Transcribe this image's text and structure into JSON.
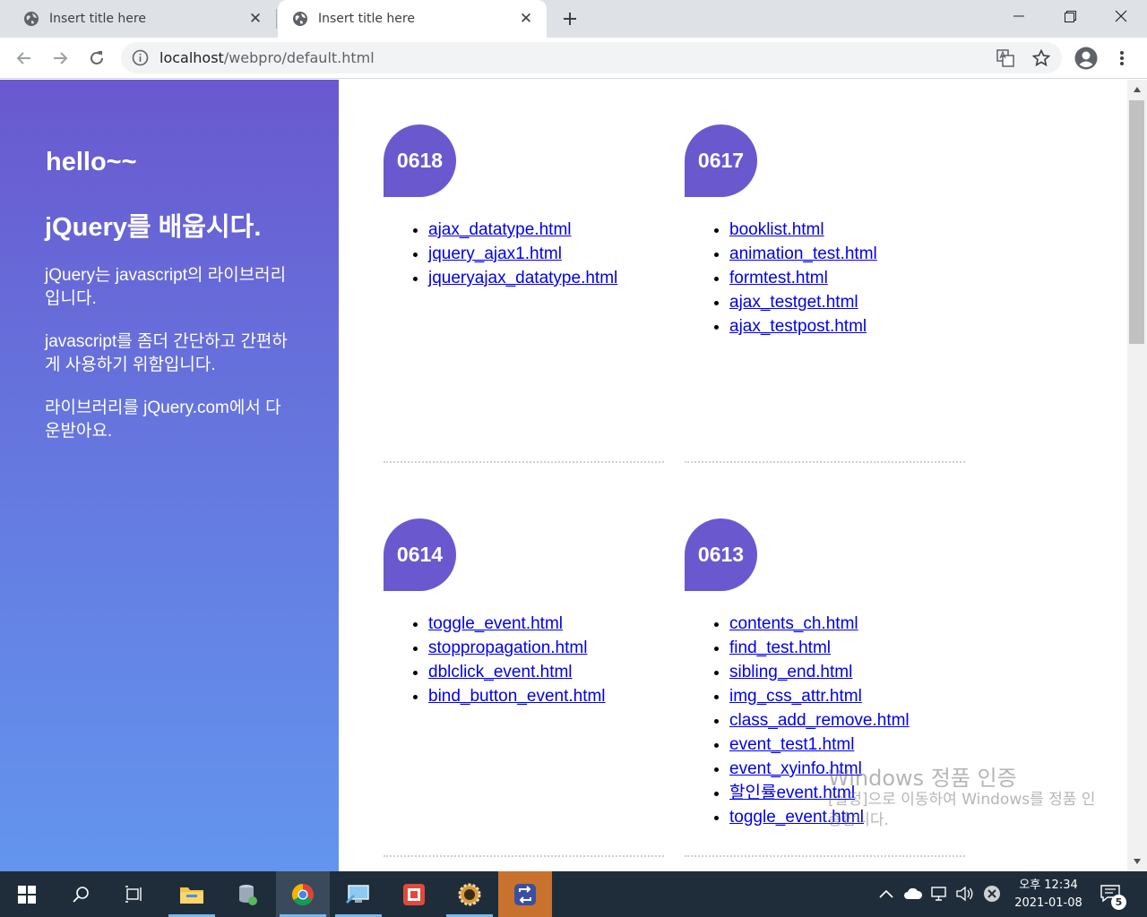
{
  "browser": {
    "tabs": [
      {
        "title": "Insert title here",
        "active": false
      },
      {
        "title": "Insert title here",
        "active": true
      }
    ],
    "url_host": "localhost",
    "url_path": "/webpro/default.html"
  },
  "sidebar": {
    "heading1": "hello~~",
    "heading2": "jQuery를 배웁시다.",
    "paragraphs": [
      "jQuery는 javascript의 라이브러리입니다.",
      "javascript를 좀더 간단하고 간편하게 사용하기 위함입니다.",
      "라이브러리를 jQuery.com에서 다운받아요."
    ]
  },
  "cards": [
    {
      "badge": "0618",
      "links": [
        "ajax_datatype.html",
        "jquery_ajax1.html",
        "jqueryajax_datatype.html"
      ]
    },
    {
      "badge": "0617",
      "links": [
        "booklist.html",
        "animation_test.html",
        "formtest.html",
        "ajax_testget.html",
        "ajax_testpost.html"
      ]
    },
    {
      "badge": "0614",
      "links": [
        "toggle_event.html",
        "stoppropagation.html",
        "dblclick_event.html",
        "bind_button_event.html"
      ]
    },
    {
      "badge": "0613",
      "links": [
        "contents_ch.html",
        "find_test.html",
        "sibling_end.html",
        "img_css_attr.html",
        "class_add_remove.html",
        "event_test1.html",
        "event_xyinfo.html",
        "할인률event.html",
        "toggle_event.html"
      ]
    }
  ],
  "watermark": {
    "line1": "Windows 정품 인증",
    "line2": "[설정]으로 이동하여 Windows를 정품 인증합니다."
  },
  "taskbar": {
    "clock_period_time": "오후 12:34",
    "clock_date": "2021-01-08",
    "notification_count": "5"
  },
  "colors": {
    "accent": "#6a58cf",
    "sidebar_top": "#6a58cf",
    "sidebar_bottom": "#6395ee",
    "link": "#0000ee"
  }
}
